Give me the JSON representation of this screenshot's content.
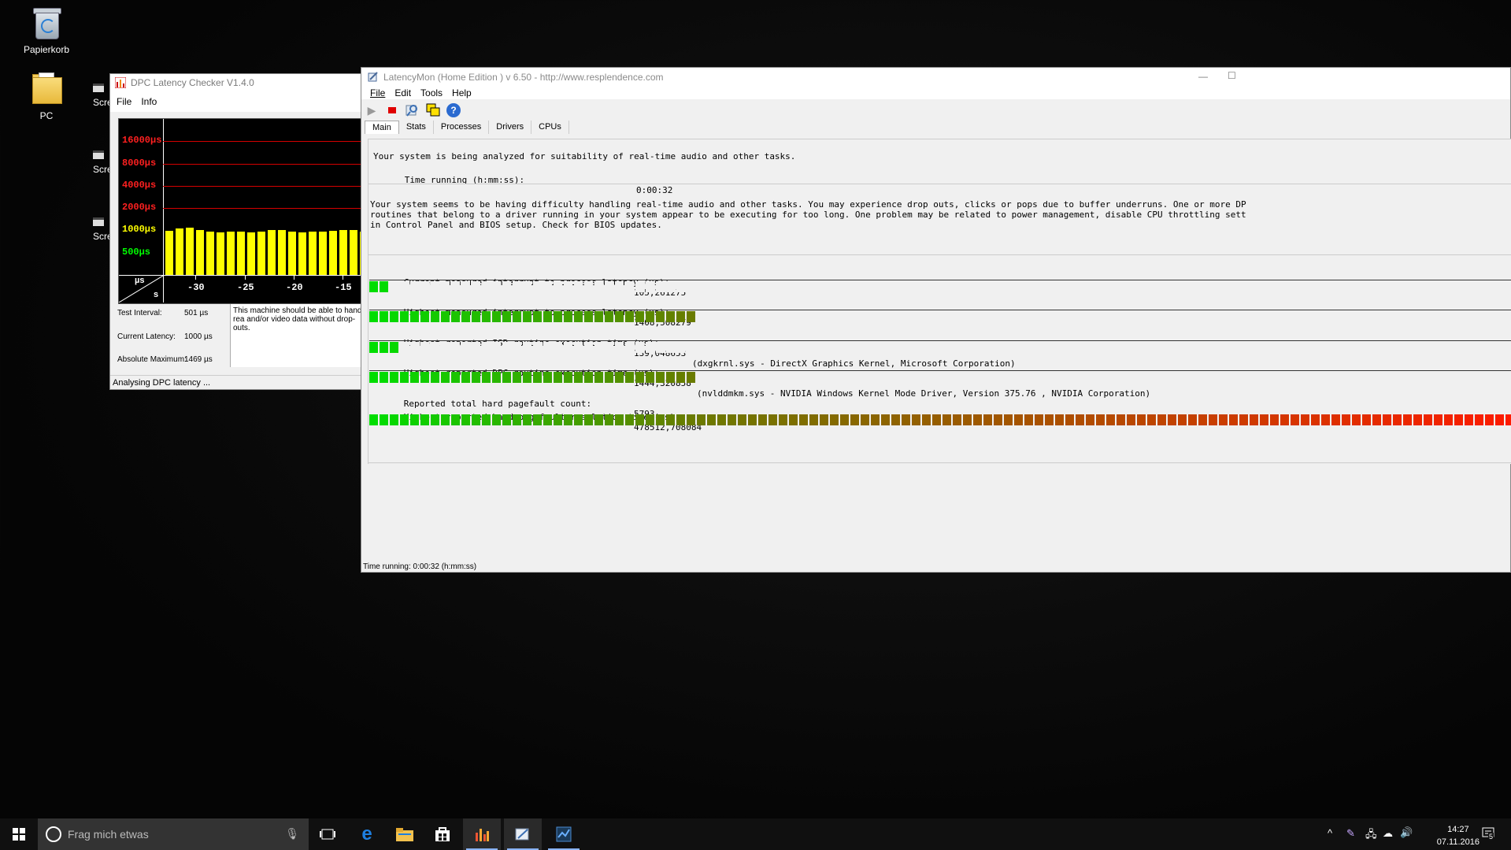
{
  "desktop": {
    "icons": [
      {
        "label": "Papierkorb"
      },
      {
        "label": "PC"
      }
    ],
    "partial_items": [
      "Scree",
      "Scree",
      "Scree"
    ]
  },
  "dpc": {
    "title": "DPC Latency Checker V1.4.0",
    "menu": [
      "File",
      "Info"
    ],
    "y_labels": [
      {
        "text": "16000µs",
        "color": "#ff2020"
      },
      {
        "text": "8000µs",
        "color": "#ff2020"
      },
      {
        "text": "4000µs",
        "color": "#ff2020"
      },
      {
        "text": "2000µs",
        "color": "#ff2020"
      },
      {
        "text": "1000µs",
        "color": "#ffff00"
      },
      {
        "text": "500µs",
        "color": "#00ff00"
      }
    ],
    "corner_top": "µs",
    "corner_bottom": "s",
    "x_ticks": [
      "-30",
      "-25",
      "-20",
      "-15"
    ],
    "chart_data": {
      "type": "bar",
      "y_scale": "log2",
      "ylim": [
        250,
        32000
      ],
      "values": [
        980,
        1060,
        1100,
        1000,
        960,
        940,
        960,
        970,
        940,
        960,
        1010,
        1000,
        960,
        950,
        960,
        960,
        980,
        1010,
        1000,
        960,
        960,
        950,
        960,
        960,
        970,
        960,
        930,
        980,
        970,
        960,
        610
      ],
      "bar_colors": {
        "normal": "#ffff00",
        "ok": "#00ff00"
      }
    },
    "info": {
      "test_interval_label": "Test Interval:",
      "test_interval_value": "501 µs",
      "current_latency_label": "Current Latency:",
      "current_latency_value": "1000 µs",
      "absolute_maximum_label": "Absolute Maximum:",
      "absolute_maximum_value": "1469 µs"
    },
    "message": "This machine should be able to handle rea and/or video data without drop-outs.",
    "status": "Analysing DPC latency ..."
  },
  "lm": {
    "title": "LatencyMon  (Home Edition )  v 6.50 - http://www.resplendence.com",
    "menu": [
      "File",
      "Edit",
      "Tools",
      "Help"
    ],
    "tabs": [
      "Main",
      "Stats",
      "Processes",
      "Drivers",
      "CPUs"
    ],
    "analysis_line": "Your system is being analyzed for suitability of real-time audio and other tasks.",
    "time_label": "Time running (h:mm:ss):",
    "time_value": "0:00:32",
    "warning_lines": [
      "Your system seems to be having difficulty handling real-time audio and other tasks. You may experience drop outs, clicks or pops due to buffer underruns. One or more DP",
      "routines that belong to a driver running in your system appear to be executing for too long. One problem may be related to power management, disable CPU throttling sett",
      "in Control Panel and BIOS setup. Check for BIOS updates."
    ],
    "metrics": [
      {
        "label": "Current measured interrupt to process latency (µs):",
        "value": "105,261275",
        "detail": "",
        "meter_level": 0.018
      },
      {
        "label": "Highest measured interrupt to process latency (µs):",
        "value": "1408,508279",
        "detail": "",
        "meter_level": 0.285
      },
      {
        "label": "Highest reported ISR routine execution time (µs):",
        "value": "139,048653",
        "detail": "(dxgkrnl.sys - DirectX Graphics Kernel, Microsoft Corporation)",
        "meter_level": 0.028
      },
      {
        "label": "Highest reported DPC routine execution time (µs):",
        "value": "1444,320858",
        "detail": "(nvlddmkm.sys - NVIDIA Windows Kernel Mode Driver, Version 375.76 , NVIDIA Corporation)",
        "meter_level": 0.285
      },
      {
        "label": "Reported total hard pagefault count:",
        "value": "5793",
        "detail": "",
        "meter_level": null
      },
      {
        "label": "Highest reported hard pagefault resolution time (µs):",
        "value": "478512,708084",
        "detail": "",
        "meter_level": 1.0
      }
    ],
    "status": "Time running: 0:00:32  (h:mm:ss)",
    "meter_colors": {
      "start": "#00dd00",
      "mid": "#6b7a00",
      "end": "#ff1a00",
      "empty": "#f0f0f0"
    }
  },
  "taskbar": {
    "search_placeholder": "Frag mich etwas",
    "time": "14:27",
    "date": "07.11.2016",
    "notification_count": "5"
  }
}
